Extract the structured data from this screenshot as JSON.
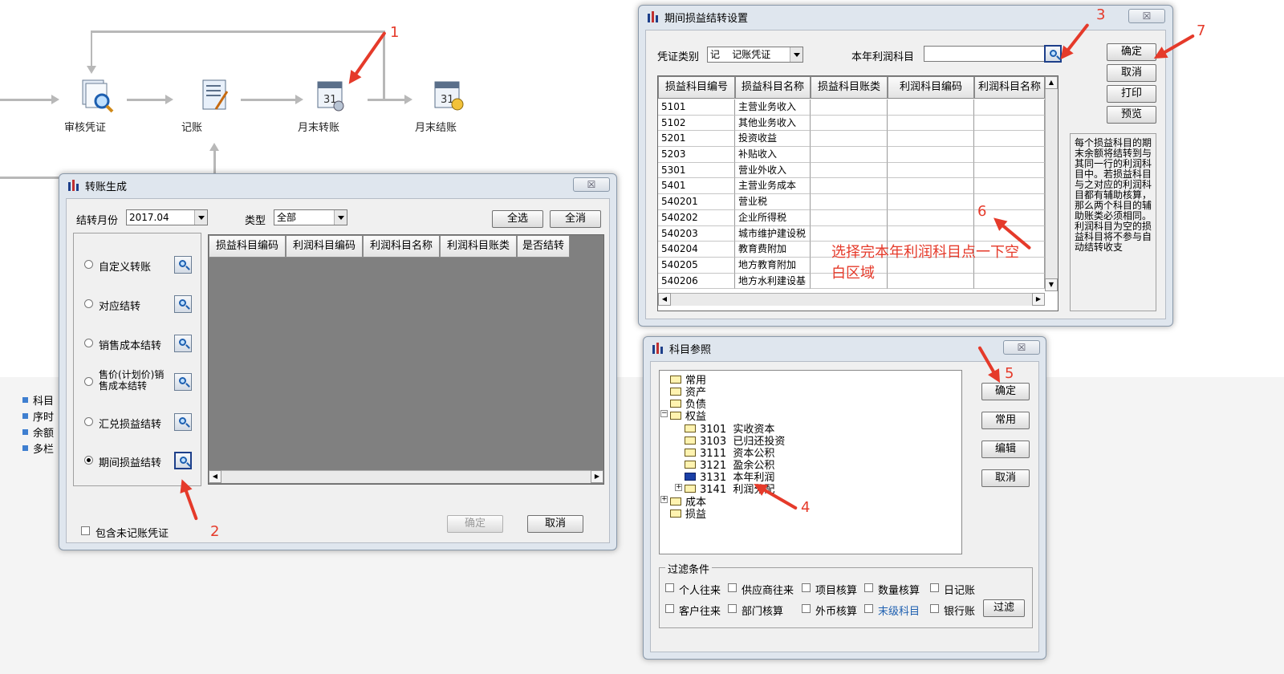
{
  "flow": {
    "nodes": [
      "审核凭证",
      "记账",
      "月末转账",
      "月末结账"
    ]
  },
  "left_list": [
    "科目",
    "序时",
    "余额",
    "多栏"
  ],
  "transfer_gen": {
    "title": "转账生成",
    "close": "☒",
    "month_label": "结转月份",
    "month_value": "2017.04",
    "type_label": "类型",
    "type_value": "全部",
    "select_all": "全选",
    "deselect_all": "全消",
    "options": [
      "自定义转账",
      "对应结转",
      "销售成本结转",
      "售价(计划价)销售成本结转",
      "汇兑损益结转",
      "期间损益结转"
    ],
    "selected_option": "期间损益结转",
    "columns": [
      "损益科目编码",
      "利润科目编码",
      "利润科目名称",
      "利润科目账类",
      "是否结转"
    ],
    "include_unposted": "包含未记账凭证",
    "ok": "确定",
    "cancel": "取消"
  },
  "pl_settings": {
    "title": "期间损益结转设置",
    "close": "☒",
    "voucher_type_label": "凭证类别",
    "voucher_type_value": "记    记账凭证",
    "profit_account_label": "本年利润科目",
    "profit_account_value": "",
    "columns": [
      "损益科目编号",
      "损益科目名称",
      "损益科目账类",
      "利润科目编码",
      "利润科目名称"
    ],
    "rows": [
      [
        "5101",
        "主营业务收入"
      ],
      [
        "5102",
        "其他业务收入"
      ],
      [
        "5201",
        "投资收益"
      ],
      [
        "5203",
        "补贴收入"
      ],
      [
        "5301",
        "营业外收入"
      ],
      [
        "5401",
        "主营业务成本"
      ],
      [
        "540201",
        "营业税"
      ],
      [
        "540202",
        "企业所得税"
      ],
      [
        "540203",
        "城市维护建设税"
      ],
      [
        "540204",
        "教育费附加"
      ],
      [
        "540205",
        "地方教育附加"
      ],
      [
        "540206",
        "地方水利建设基"
      ]
    ],
    "buttons": [
      "确定",
      "取消",
      "打印",
      "预览"
    ],
    "info": "每个损益科目的期末余额将结转到与其同一行的利润科目中。若损益科目与之对应的利润科目都有辅助核算，那么两个科目的辅助账类必须相同。利润科目为空的损益科目将不参与自动结转收支"
  },
  "account_ref": {
    "title": "科目参照",
    "close": "☒",
    "tree": [
      "常用",
      "资产",
      "负债",
      "权益",
      "3101  实收资本",
      "3103  已归还投资",
      "3111  资本公积",
      "3121  盈余公积",
      "3131  本年利润",
      "3141  利润分配",
      "成本",
      "损益"
    ],
    "buttons": [
      "确定",
      "常用",
      "编辑",
      "取消"
    ],
    "filter_title": "过滤条件",
    "filters_row1": [
      "个人往来",
      "供应商往来",
      "项目核算",
      "数量核算",
      "日记账"
    ],
    "filters_row2": [
      "客户往来",
      "部门核算",
      "外币核算",
      "末级科目",
      "银行账"
    ],
    "filter_button": "过滤",
    "highlight_color": "#1d5fb0"
  },
  "annotations": {
    "n1": "1",
    "n2": "2",
    "n3": "3",
    "n4": "4",
    "n5": "5",
    "n6": "6",
    "n7": "7",
    "note": "选择完本年利润科目点一下空白区域",
    "color": "#e53a2a"
  }
}
